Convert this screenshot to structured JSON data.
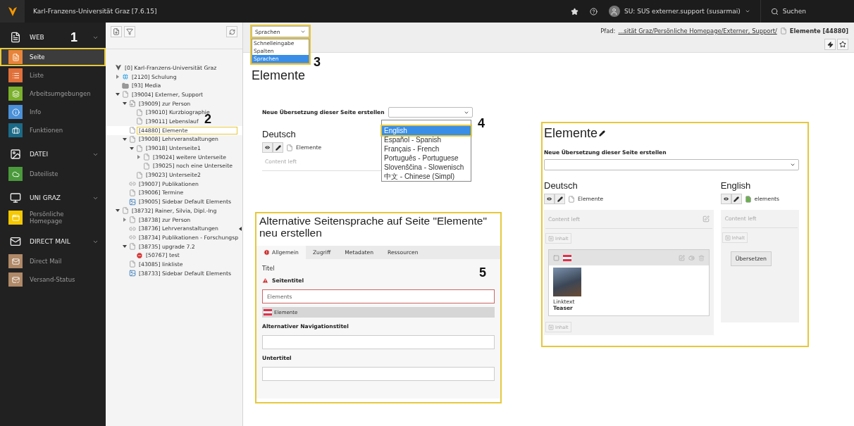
{
  "topbar": {
    "title": "Karl-Franzens-Universität Graz [7.6.15]",
    "user": "SU: SUS externer.support (susarmai)",
    "search": "Suchen"
  },
  "sidebar": {
    "groups": [
      {
        "label": "WEB",
        "kind": "page",
        "annotation": "1",
        "items": [
          {
            "label": "Seite",
            "kind": "page",
            "color": "#e8843a",
            "selected": true
          },
          {
            "label": "Liste",
            "kind": "list",
            "color": "#e0703a",
            "selected": false
          },
          {
            "label": "Arbeitsumgebungen",
            "kind": "layers",
            "color": "#7ab02c",
            "selected": false
          },
          {
            "label": "Info",
            "kind": "info",
            "color": "#4a90d9",
            "selected": false
          },
          {
            "label": "Funktionen",
            "kind": "briefcase",
            "color": "#1b6a87",
            "selected": false
          }
        ]
      },
      {
        "label": "DATEI",
        "kind": "image",
        "items": [
          {
            "label": "Dateiliste",
            "kind": "cloud",
            "color": "#4a9a3c",
            "selected": false
          }
        ]
      },
      {
        "label": "UNI GRAZ",
        "kind": "window",
        "items": [
          {
            "label": "Persönliche Homepage",
            "kind": "home",
            "color": "#f5c800",
            "selected": false
          }
        ]
      },
      {
        "label": "DIRECT MAIL",
        "kind": "mail",
        "items": [
          {
            "label": "Direct Mail",
            "kind": "mail",
            "color": "#b08968",
            "selected": false
          },
          {
            "label": "Versand-Status",
            "kind": "mailcheck",
            "color": "#b08968",
            "selected": false
          }
        ]
      }
    ]
  },
  "tree": {
    "annotation": "2",
    "items": [
      {
        "label": "[0] Karl-Franzens-Universität Graz",
        "kind": "root",
        "selected": false,
        "children": [
          {
            "label": "[2120] Schulung",
            "kind": "globe",
            "expanded": false,
            "selected": false
          },
          {
            "label": "[93] Media",
            "kind": "folder",
            "selected": false
          },
          {
            "label": "[39004] Externer, Support",
            "kind": "page",
            "expanded": true,
            "selected": false,
            "children": [
              {
                "label": "[39009] zur Person",
                "kind": "shortcut",
                "expanded": true,
                "selected": false,
                "children": [
                  {
                    "label": "[39010] Kurzbiographie",
                    "kind": "page",
                    "selected": false
                  },
                  {
                    "label": "[39011] Lebenslauf",
                    "kind": "page",
                    "selected": false
                  }
                ]
              },
              {
                "label": "[44880] Elemente",
                "kind": "page",
                "selected": true
              },
              {
                "label": "[39008] Lehrveranstaltungen",
                "kind": "page",
                "expanded": true,
                "selected": false,
                "children": [
                  {
                    "label": "[39018] Unterseite1",
                    "kind": "page",
                    "expanded": true,
                    "selected": false,
                    "children": [
                      {
                        "label": "[39024] weitere Unterseite",
                        "kind": "page",
                        "expanded": false,
                        "selected": false
                      },
                      {
                        "label": "[39025] noch eine Unterseite",
                        "kind": "page",
                        "selected": false
                      }
                    ]
                  },
                  {
                    "label": "[39023] Unterseite2",
                    "kind": "page",
                    "selected": false
                  }
                ]
              },
              {
                "label": "[39007] Publikationen",
                "kind": "link",
                "selected": false
              },
              {
                "label": "[39006] Termine",
                "kind": "page",
                "selected": false
              },
              {
                "label": "[39005] Sidebar Default Elements",
                "kind": "sidebar",
                "selected": false
              }
            ]
          },
          {
            "label": "[38732] Rainer, Silvia, Dipl.-Ing",
            "kind": "page",
            "expanded": true,
            "selected": false,
            "children": [
              {
                "label": "[38738] zur Person",
                "kind": "page",
                "expanded": false,
                "selected": false
              },
              {
                "label": "[38736] Lehrveranstaltungen",
                "kind": "link",
                "selected": false
              },
              {
                "label": "[38734] Publikationen - Forschungsp",
                "kind": "link",
                "selected": false
              },
              {
                "label": "[38735] upgrade 7.2",
                "kind": "page",
                "expanded": true,
                "selected": false,
                "children": [
                  {
                    "label": "[50767] test",
                    "kind": "restricted",
                    "selected": false
                  }
                ]
              },
              {
                "label": "[43085] linkliste",
                "kind": "page",
                "selected": false
              },
              {
                "label": "[38733] Sidebar Default Elements",
                "kind": "sidebar",
                "selected": false
              }
            ]
          }
        ]
      }
    ]
  },
  "toolbar": {
    "view_select": {
      "value": "Sprachen",
      "options": [
        {
          "label": "Schnelleingabe",
          "selected": false
        },
        {
          "label": "Spalten",
          "selected": false
        },
        {
          "label": "Sprachen",
          "selected": true
        }
      ]
    },
    "path_label": "Pfad:",
    "path": "...sität Graz/Persönliche Homepage/Externer, Support/",
    "path_page": "Elemente [44880]"
  },
  "left_view": {
    "annotation": "3",
    "page_title": "Elemente",
    "translation_label": "Neue Übersetzung dieser Seite erstellen",
    "annotation_2": "4",
    "translation_options": [
      {
        "label": "English",
        "selected": true
      },
      {
        "label": "Español - Spanish",
        "selected": false
      },
      {
        "label": "Français - French",
        "selected": false
      },
      {
        "label": "Português - Portuguese",
        "selected": false
      },
      {
        "label": "Slovenščina - Slowenisch",
        "selected": false
      },
      {
        "label": "中文 - Chinese (Simpl)",
        "selected": false
      }
    ],
    "language": "Deutsch",
    "page": "Elemente",
    "column": "Content left"
  },
  "form": {
    "title": "Alternative Seitensprache auf Seite \"Elemente\" neu erstellen",
    "tabs": [
      {
        "label": "Allgemein",
        "selected": true,
        "error": true
      },
      {
        "label": "Zugriff",
        "selected": false,
        "error": false
      },
      {
        "label": "Metadaten",
        "selected": false,
        "error": false
      },
      {
        "label": "Ressourcen",
        "selected": false,
        "error": false
      }
    ],
    "section": "Titel",
    "annotation": "5",
    "fields": [
      {
        "label": "Seitentitel",
        "invalid": true,
        "value": "Elements",
        "original": "Elemente"
      },
      {
        "label": "Alternativer Navigationstitel",
        "invalid": false
      },
      {
        "label": "Untertitel",
        "invalid": false
      }
    ]
  },
  "right_view": {
    "page_title": "Elemente",
    "translation_label": "Neue Übersetzung dieser Seite erstellen",
    "columns": [
      {
        "kind": "original",
        "language": "Deutsch",
        "page": "Elemente",
        "column": "Content left",
        "new_button": "Inhalt",
        "element": {
          "link": "Linktext",
          "title": "Teaser"
        },
        "new_button_2": "Inhalt"
      },
      {
        "kind": "translation",
        "language": "English",
        "page": "elements",
        "column": "Content left",
        "new_button": "Inhalt",
        "translate_button": "Übersetzen"
      }
    ]
  }
}
